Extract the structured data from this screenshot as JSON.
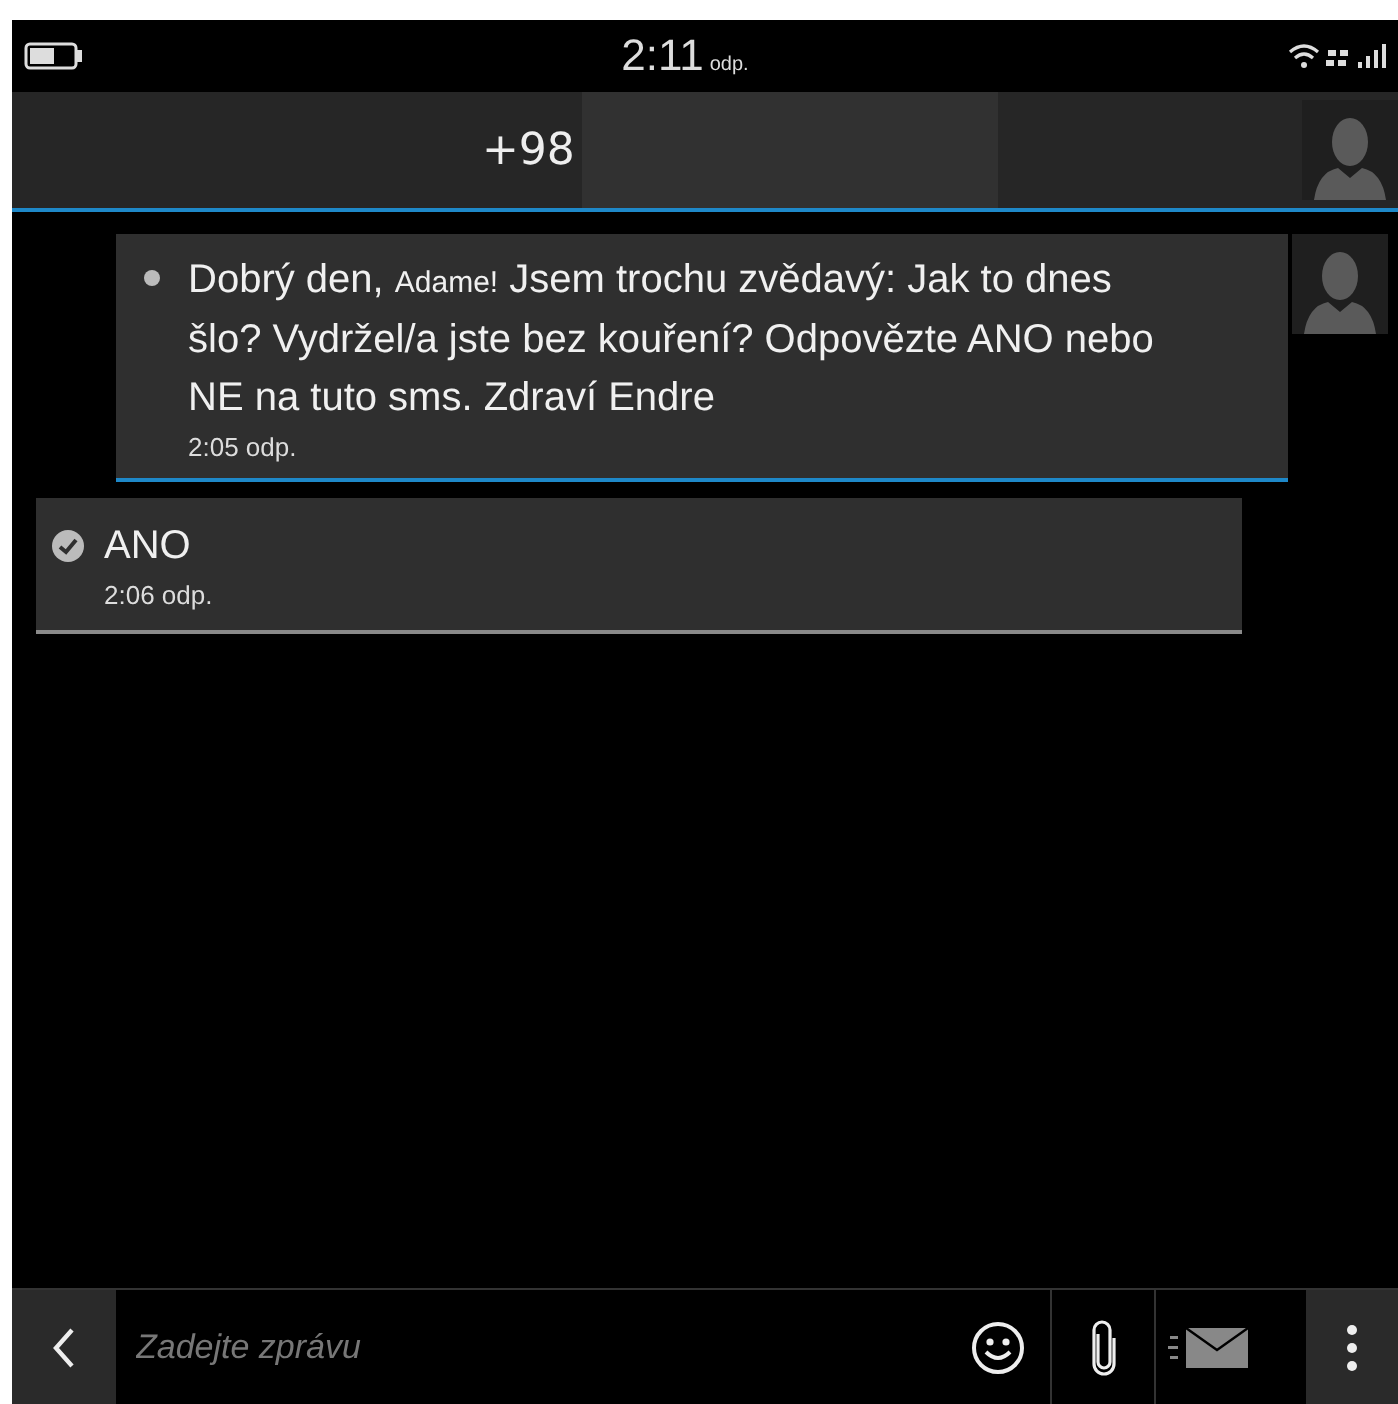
{
  "status_bar": {
    "time": "2:11",
    "period": "odp."
  },
  "header": {
    "contact": "+98"
  },
  "messages": [
    {
      "kind": "incoming",
      "delivered": false,
      "parts": [
        {
          "text": "Dobrý den, ",
          "small": false
        },
        {
          "text": "Adame!",
          "small": true
        },
        {
          "text": " Jsem trochu zvědavý: Jak to dnes šlo? Vydržel/a jste bez kouření? Odpovězte ANO nebo NE na tuto sms. Zdraví Endre",
          "small": false
        }
      ],
      "time": "2:05 odp."
    },
    {
      "kind": "outgoing",
      "delivered": true,
      "parts": [
        {
          "text": "ANO",
          "small": false
        }
      ],
      "time": "2:06 odp."
    }
  ],
  "composer": {
    "placeholder": "Zadejte zprávu"
  }
}
